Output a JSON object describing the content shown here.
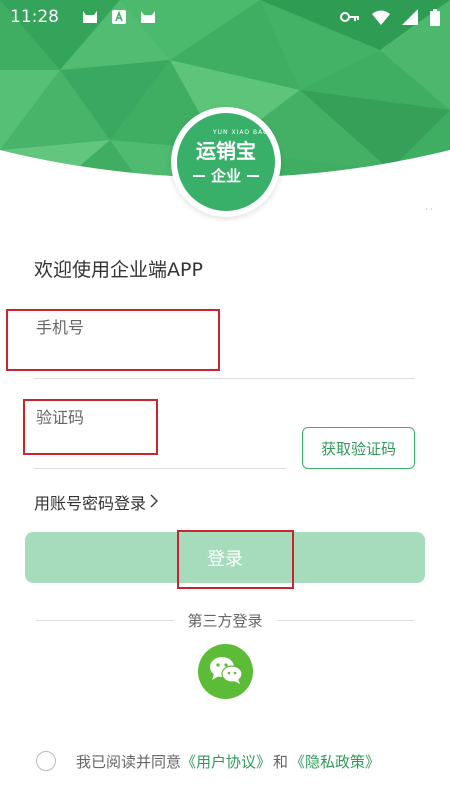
{
  "status_bar": {
    "time": "11:28",
    "left_icons": [
      "cat-icon",
      "text-a-icon",
      "cat-icon"
    ],
    "right_icons": [
      "key-icon",
      "wifi-icon",
      "signal-icon",
      "battery-icon"
    ]
  },
  "logo": {
    "brand": "运销宝",
    "pinyin": "YUN XIAO BAO",
    "tag": "企业"
  },
  "welcome": "欢迎使用企业端APP",
  "form": {
    "phone_label": "手机号",
    "code_label": "验证码",
    "get_code_button": "获取验证码",
    "account_login_link": "用账号密码登录",
    "account_login_chevron": "〉",
    "login_button": "登录"
  },
  "third_party": {
    "label": "第三方登录",
    "wechat_icon": "wechat-icon"
  },
  "agreement": {
    "prefix": "我已阅读并同意",
    "user_agreement": "《用户协议》",
    "and": "和",
    "privacy_policy": "《隐私政策》"
  },
  "colors": {
    "brand_green": "#39b06a",
    "login_button_disabled": "#a6dcbb",
    "wechat_green": "#5cbc38",
    "highlight_red": "#c8252c"
  }
}
